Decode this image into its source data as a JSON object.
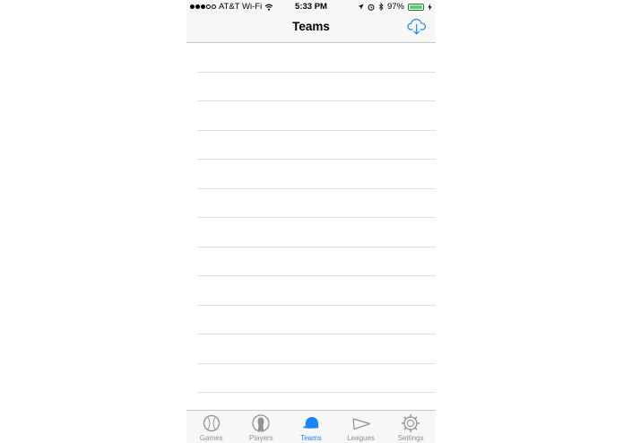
{
  "status_bar": {
    "carrier": "AT&T Wi-Fi",
    "time": "5:33 PM",
    "battery_percent_text": "97%",
    "battery_level": 0.97,
    "battery_color": "#4cd964"
  },
  "nav": {
    "title": "Teams",
    "right_button_icon": "cloud-download-icon",
    "accent_color": "#1a82fb"
  },
  "table": {
    "row_count": 12,
    "rows": []
  },
  "tab_bar": {
    "active_tab": "Teams",
    "tabs": [
      {
        "label": "Games",
        "icon": "baseball-icon",
        "active": false
      },
      {
        "label": "Players",
        "icon": "player-silhouette-icon",
        "active": false
      },
      {
        "label": "Teams",
        "icon": "cap-icon",
        "active": true
      },
      {
        "label": "Leagues",
        "icon": "pennant-icon",
        "active": false
      },
      {
        "label": "Settings",
        "icon": "gear-icon",
        "active": false
      }
    ]
  }
}
